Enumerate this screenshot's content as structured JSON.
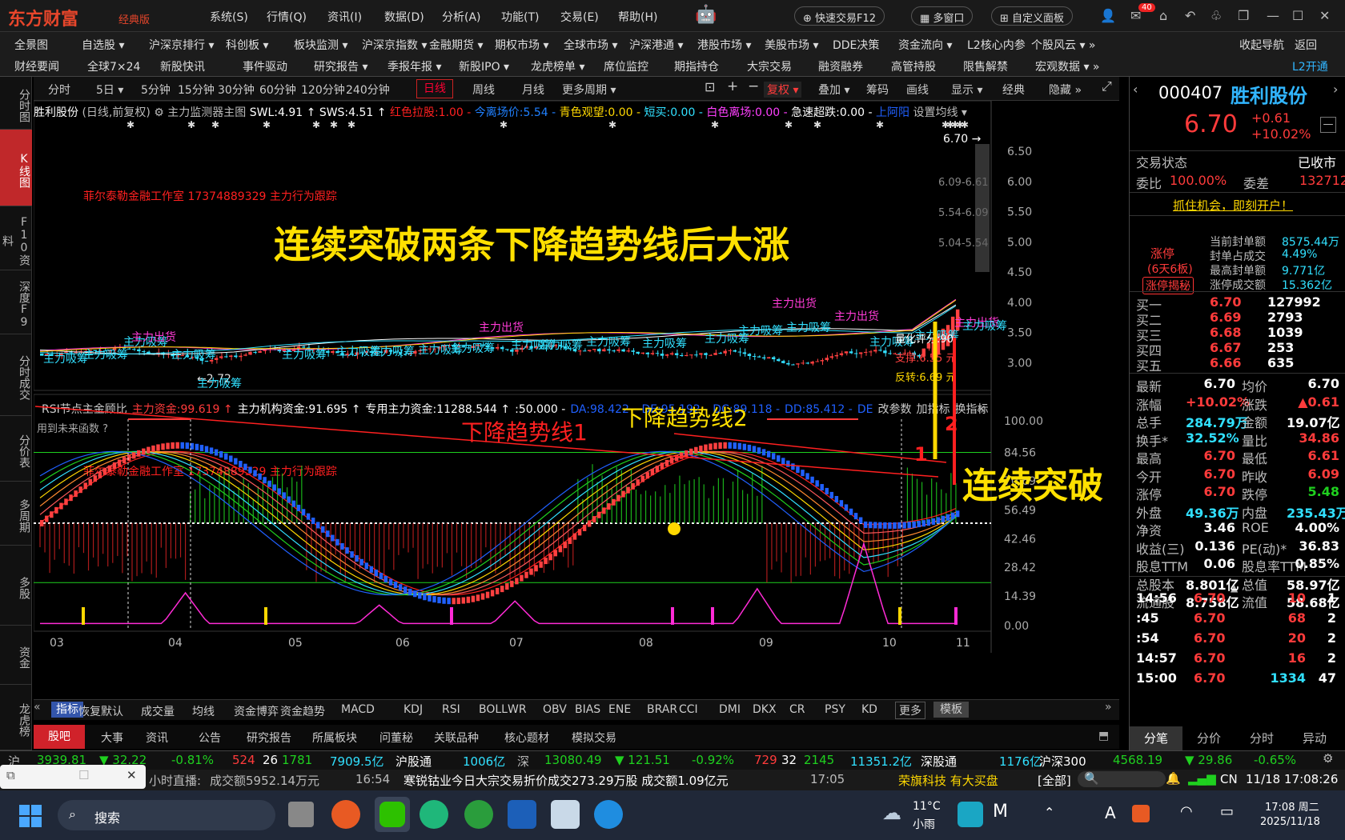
{
  "app": {
    "logo": "东方财富",
    "edition": "经典版"
  },
  "menu": [
    "系统(S)",
    "行情(Q)",
    "资讯(I)",
    "数据(D)",
    "分析(A)",
    "功能(T)",
    "交易(E)",
    "帮助(H)"
  ],
  "top_actions": {
    "fast_trade": "快速交易F12",
    "multi_window": "多窗口",
    "custom_panel": "自定义面板",
    "mail_badge": "40"
  },
  "nav_row1": [
    "全景图",
    "自选股 ▾",
    "沪深京排行 ▾",
    "科创板 ▾",
    "板块监测 ▾",
    "沪深京指数 ▾",
    "金融期货 ▾",
    "期权市场 ▾",
    "全球市场 ▾",
    "沪深港通 ▾",
    "港股市场 ▾",
    "美股市场 ▾",
    "DDE决策",
    "资金流向 ▾",
    "L2核心内参",
    "个股风云 ▾ »",
    "收起导航",
    "返回"
  ],
  "nav_row2": [
    "财经要闻",
    "全球7×24",
    "新股快讯",
    "事件驱动",
    "研究报告 ▾",
    "季报年报 ▾",
    "新股IPO ▾",
    "龙虎榜单 ▾",
    "席位监控",
    "期指持仓",
    "大宗交易",
    "融资融券",
    "高管持股",
    "限售解禁",
    "宏观数据 ▾ »",
    "L2开通"
  ],
  "left_tabs": [
    "分时图",
    "K线图",
    "F10资料",
    "深度F9",
    "分时成交",
    "分价表",
    "多周期",
    "多股",
    "资金",
    "龙虎榜"
  ],
  "periods": [
    "分时",
    "5日 ▾",
    "5分钟",
    "15分钟",
    "30分钟",
    "60分钟",
    "120分钟",
    "240分钟",
    "日线",
    "周线",
    "月线",
    "更多周期 ▾"
  ],
  "tools": [
    "复权 ▾",
    "叠加 ▾",
    "筹码",
    "画线",
    "显示 ▾",
    "经典",
    "隐藏 »"
  ],
  "indicator_line": {
    "name": "胜利股份",
    "mode": "(日线,前复权)",
    "main": "主力监测器主图",
    "swl": "SWL:4.91 ↑",
    "sws": "SWS:4.51 ↑",
    "a": "红色拉股:1.00 -",
    "b": "今离场价:5.54 -",
    "c": "青色观望:0.00 -",
    "d": "短买:0.00 -",
    "e": "白色离场:0.00 -",
    "f": "急速超跌:0.00 -",
    "g": "上阿阳",
    "h": "设置均线 ▾"
  },
  "lower_indicator": {
    "name": "RSI节点主金顾比",
    "a": "主力资金:99.619 ↑",
    "b": "主力机构资金:91.695 ↑",
    "c": "专用主力资金:11288.544 ↑",
    "d": ":50.000 -",
    "e": "DA:98.422 -",
    "f": "DE:95.192 -",
    "g": "DC:89.118 -",
    "h": "DD:85.412 -",
    "i": "DE",
    "j": "改参数",
    "k": "加指标",
    "l": "换指标",
    "future": "用到未来函数 ?"
  },
  "annotations": {
    "headline": "连续突破两条下降趋势线后大涨",
    "line1": "下降趋势线1",
    "line2": "下降趋势线2",
    "breakout": "连续突破",
    "n1": "1",
    "n2": "2",
    "studio": "菲尔泰勒金融工作室 17374889329 主力行为跟踪",
    "studio2": "菲尔泰勒金融工作室 17374889329 主力行为跟踪",
    "low": "←2.72",
    "high": "6.70 →",
    "lq": "量化评分:90",
    "sup": "支撑:6.55 元",
    "rev": "反转:6.69 元"
  },
  "price_axis": [
    "6.50",
    "6.00",
    "5.50",
    "5.00",
    "4.50",
    "4.00",
    "3.50",
    "3.00"
  ],
  "price_bands": [
    "6.09-6.61",
    "5.54-6.09",
    "5.04-5.54"
  ],
  "ind_axis": [
    "100.00",
    "84.56",
    "70.69",
    "56.49",
    "42.46",
    "28.42",
    "14.39",
    "0.00"
  ],
  "months": [
    "03",
    "04",
    "05",
    "06",
    "07",
    "08",
    "09",
    "10",
    "11"
  ],
  "labels_buy": "主力吸筹",
  "labels_sell": "主力出货",
  "bottom_tabs": [
    "指标",
    "恢复默认",
    "成交量",
    "均线",
    "资金博弈",
    "资金趋势",
    "MACD",
    "KDJ",
    "RSI",
    "BOLL",
    "WR",
    "OBV",
    "BIAS",
    "ENE",
    "BRAR",
    "CCI",
    "DMI",
    "DKX",
    "CR",
    "PSY",
    "KD",
    "更多",
    "模板"
  ],
  "info_tabs": [
    "股吧",
    "大事",
    "资讯",
    "公告",
    "研究报告",
    "所属板块",
    "问董秘",
    "关联品种",
    "核心题材",
    "模拟交易"
  ],
  "stock": {
    "code": "000407",
    "name": "胜利股份",
    "price": "6.70",
    "chg": "+0.61",
    "pct": "+10.02%",
    "status_label": "交易状态",
    "status": "已收市",
    "weibi_label": "委比",
    "weibi": "100.00%",
    "weicha_label": "委差",
    "weicha": "132712",
    "promo": "抓住机会，即刻开户！",
    "limit": "涨停",
    "limit_days": "(6天6板)",
    "limit_btn": "涨停揭秘",
    "lu": [
      [
        "当前封单额",
        "8575.44万"
      ],
      [
        "封单占成交",
        "4.49%"
      ],
      [
        "最高封单额",
        "9.771亿"
      ],
      [
        "涨停成交额",
        "15.362亿"
      ]
    ],
    "bids": [
      [
        "买一",
        "6.70",
        "127992"
      ],
      [
        "买二",
        "6.69",
        "2793"
      ],
      [
        "买三",
        "6.68",
        "1039"
      ],
      [
        "买四",
        "6.67",
        "253"
      ],
      [
        "买五",
        "6.66",
        "635"
      ]
    ],
    "stats": [
      [
        "最新",
        "6.70",
        "均价",
        "6.70"
      ],
      [
        "涨幅",
        "+10.02%",
        "涨跌",
        "▲0.61"
      ],
      [
        "总手",
        "284.79万",
        "金额",
        "19.07亿"
      ],
      [
        "换手*",
        "32.52%",
        "量比",
        "34.86"
      ],
      [
        "最高",
        "6.70",
        "最低",
        "6.61"
      ],
      [
        "今开",
        "6.70",
        "昨收",
        "6.09"
      ],
      [
        "涨停",
        "6.70",
        "跌停",
        "5.48"
      ],
      [
        "外盘",
        "49.36万",
        "内盘",
        "235.43万"
      ],
      [
        "净资",
        "3.46",
        "ROE",
        "4.00%"
      ],
      [
        "收益(三)",
        "0.136",
        "PE(动)*",
        "36.83"
      ],
      [
        "股息TTM",
        "0.06",
        "股息率TTM",
        "0.85%"
      ],
      [
        "总股本",
        "8.801亿",
        "总值",
        "58.97亿"
      ],
      [
        "流通股",
        "8.758亿",
        "流值",
        "58.68亿"
      ]
    ],
    "ticks": [
      [
        "14:56",
        "6.70",
        "10",
        "1"
      ],
      [
        ":45",
        "6.70",
        "68",
        "2"
      ],
      [
        ":54",
        "6.70",
        "20",
        "2"
      ],
      [
        "14:57",
        "6.70",
        "16",
        "2"
      ],
      [
        "15:00",
        "6.70",
        "1334",
        "47"
      ]
    ],
    "tabs": [
      "分笔",
      "分价",
      "分时",
      "异动"
    ]
  },
  "ticker": {
    "sh": "沪",
    "sh_val": "3939.81",
    "sh_chg": "▼ 32.22",
    "sh_pct": "-0.81%",
    "sh_up": "524",
    "sh_flat": "26",
    "sh_down": "1781",
    "sh_amt": "7909.5亿",
    "hgt": "沪股通",
    "hgt_val": "1006亿",
    "sz": "深",
    "sz_val": "13080.49",
    "sz_chg": "▼ 121.51",
    "sz_pct": "-0.92%",
    "sz_up": "729",
    "sz_flat": "32",
    "sz_down": "2145",
    "sz_amt": "11351.2亿",
    "sgt": "深股通",
    "sgt_val": "1176亿",
    "hs": "沪深300",
    "hs_val": "4568.19",
    "hs_chg": "▼ 29.86",
    "hs_pct": "-0.65%"
  },
  "news": {
    "a": "小时直播:",
    "b": "成交额5952.14万元",
    "t1": "16:54",
    "c": "寒锐钴业今日大宗交易折价成交273.29万股 成交额1.09亿元",
    "t2": "17:05",
    "d": "荣旗科技 有大买盘",
    "e": "[全部]",
    "f": "CN",
    "g": "11/18",
    "h": "17:08:26"
  },
  "taskbar": {
    "search": "搜索",
    "weather": "11°C",
    "weather2": "小雨",
    "time": "17:08 周二",
    "date": "2025/11/18"
  },
  "colors": {
    "red": "#ff3b3b",
    "green": "#1fd01f",
    "yellow": "#ffd800",
    "magenta": "#ff2bd6",
    "cyan": "#31e0ff"
  }
}
